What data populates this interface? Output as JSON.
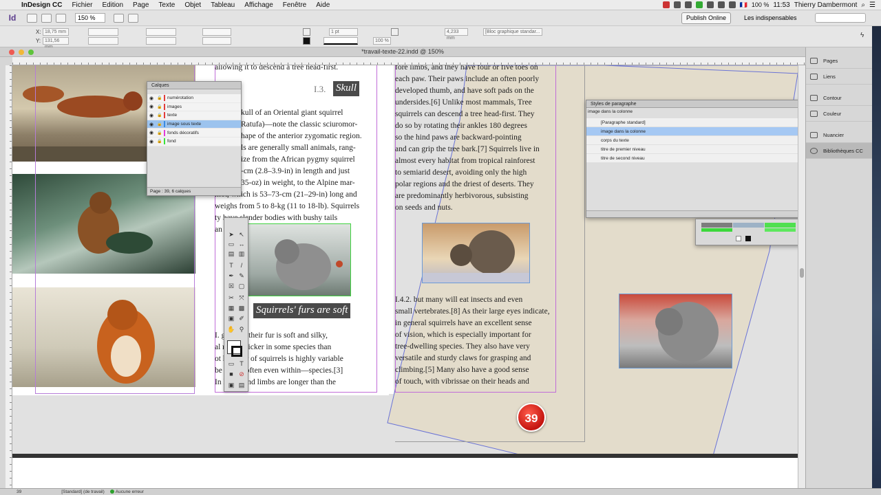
{
  "menubar": {
    "app": "InDesign CC",
    "items": [
      "Fichier",
      "Edition",
      "Page",
      "Texte",
      "Objet",
      "Tableau",
      "Affichage",
      "Fenêtre",
      "Aide"
    ],
    "battery": "100 %",
    "time": "11:53",
    "user": "Thierry Dambermont"
  },
  "appbar": {
    "logo": "Id",
    "zoom": "150 %",
    "publish": "Publish Online",
    "workspace": "Les indispensables"
  },
  "control": {
    "x": "18,75 mm",
    "y": "131,56 mm",
    "stroke": "1 pt",
    "percent": "100 %",
    "size": "4,233 mm",
    "object_style": "[Bloc graphique standar..."
  },
  "document": {
    "tab_title": "*travail-texte-22.indd @ 150%",
    "page_number": "39"
  },
  "headings": {
    "skull_prefix": "I.3.",
    "skull": "Skull",
    "furs": "Squirrels' furs are soft"
  },
  "left_column": [
    "allowing it to descend a tree head-first.",
    "kull of an Oriental giant squirrel",
    "Ratufa)—note the classic sciuromor-",
    "hape of the anterior zygomatic region.",
    "ls are generally small animals, rang-",
    "ize from the African pygmy squirrel",
    "-cm (2.8–3.9-in) in length and just",
    "35-oz) in weight, to the Alpine mar-",
    "mot, which is 53–73-cm (21–29-in) long and",
    "weighs from 5 to 8-kg (11 to 18-lb). Squirrels",
    "ty      have slender bodies with bushy tails",
    "an        e eyes."
  ],
  "left_column_bottom": [
    "I.       general, their fur is soft and silky,",
    "al       much thicker in some species than",
    "ot      he color of squirrels is highly variable",
    "be      —and often even within—species.[3]",
    "In       l, the hind limbs are longer than the"
  ],
  "right_column": [
    "fore limbs, and they have four or five toes on",
    "each paw. Their paws include an often poorly",
    "developed thumb, and have soft pads on the",
    "undersides.[6] Unlike most mammals, Tree",
    "squirrels can descend a tree head-first. They",
    "do so by rotating their ankles 180 degrees",
    "so the hind paws are backward-pointing",
    "and can grip the tree bark.[7] Squirrels live in",
    "almost every habitat from tropical rainforest",
    "to semiarid desert, avoiding only the high",
    "polar regions and the driest of deserts. They",
    "are predominantly herbivorous, subsisting",
    "on seeds and nuts."
  ],
  "right_column_bottom": [
    "I.4.2. but many will eat insects and even",
    "small vertebrates.[8] As their large eyes indicate,",
    "in general squirrels have an excellent sense",
    "of vision, which is especially important for",
    "tree-dwelling species. They also have very",
    "versatile and sturdy claws for grasping and",
    "climbing.[5] Many also have a good sense",
    "of touch, with vibrissae on their heads and"
  ],
  "layers_panel": {
    "title": "Calques",
    "layers": [
      {
        "name": "numérotation",
        "color": "#e23b3b"
      },
      {
        "name": "images",
        "color": "#e23b3b"
      },
      {
        "name": "texte",
        "color": "#e23b3b"
      },
      {
        "name": "image sous texte",
        "color": "#3b8be2"
      },
      {
        "name": "fonds décoratifs",
        "color": "#e23bd7"
      },
      {
        "name": "fond",
        "color": "#3be23b"
      }
    ],
    "footer": "Page : 39, 6 calques"
  },
  "styles_panel": {
    "title": "Styles de paragraphe",
    "current": "image dans la colonne",
    "styles": [
      "[Paragraphe standard]",
      "image dans la colonne",
      "corps du texte",
      "titre de premier niveau",
      "titre de second niveau"
    ]
  },
  "sidebar": {
    "items": [
      "Pages",
      "Liens",
      "Contour",
      "Couleur",
      "Nuancier",
      "Bibliothèques CC"
    ]
  },
  "status": {
    "page": "39",
    "preflight_profile": "[Standard] (de travail)",
    "errors": "Aucune erreur"
  },
  "colors": {
    "accent_purple": "#5a3a8c",
    "margin": "#c06cd8",
    "link": "#2a2ad0",
    "badge": "#c41510"
  }
}
